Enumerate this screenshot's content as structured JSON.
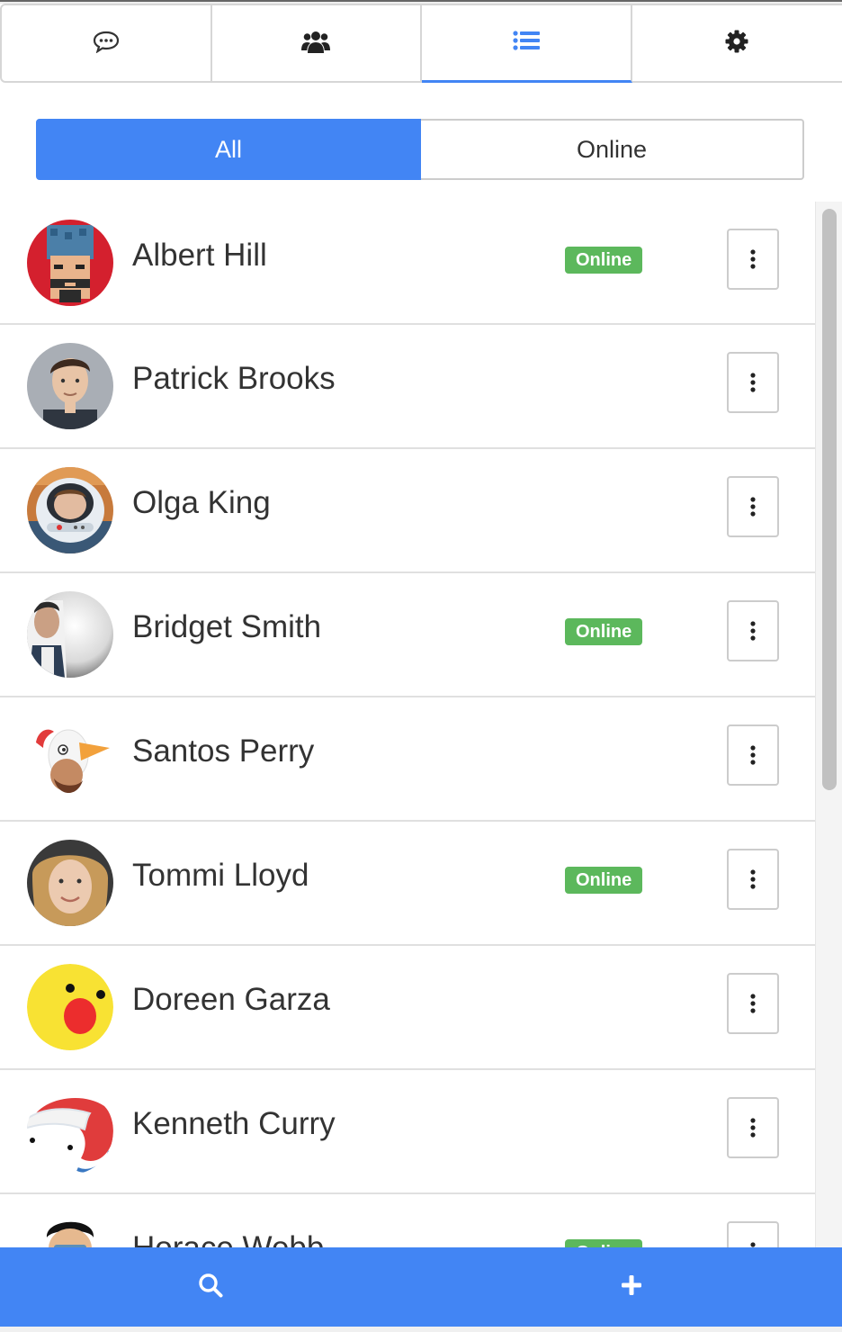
{
  "tabs": [
    {
      "icon": "comment-icon",
      "active": false
    },
    {
      "icon": "users-icon",
      "active": false
    },
    {
      "icon": "list-icon",
      "active": true
    },
    {
      "icon": "gear-icon",
      "active": false
    }
  ],
  "filter": {
    "all_label": "All",
    "online_label": "Online",
    "selected": "All"
  },
  "contacts": [
    {
      "name": "Albert Hill",
      "status": "Online"
    },
    {
      "name": "Patrick Brooks",
      "status": ""
    },
    {
      "name": "Olga King",
      "status": ""
    },
    {
      "name": "Bridget Smith",
      "status": "Online"
    },
    {
      "name": "Santos Perry",
      "status": ""
    },
    {
      "name": "Tommi Lloyd",
      "status": "Online"
    },
    {
      "name": "Doreen Garza",
      "status": ""
    },
    {
      "name": "Kenneth Curry",
      "status": ""
    },
    {
      "name": "Horace Webb",
      "status": "Online"
    }
  ],
  "bottom_bar": {
    "search_icon": "search-icon",
    "add_icon": "plus-icon"
  },
  "colors": {
    "accent": "#4285f4",
    "online": "#5cb85c"
  }
}
